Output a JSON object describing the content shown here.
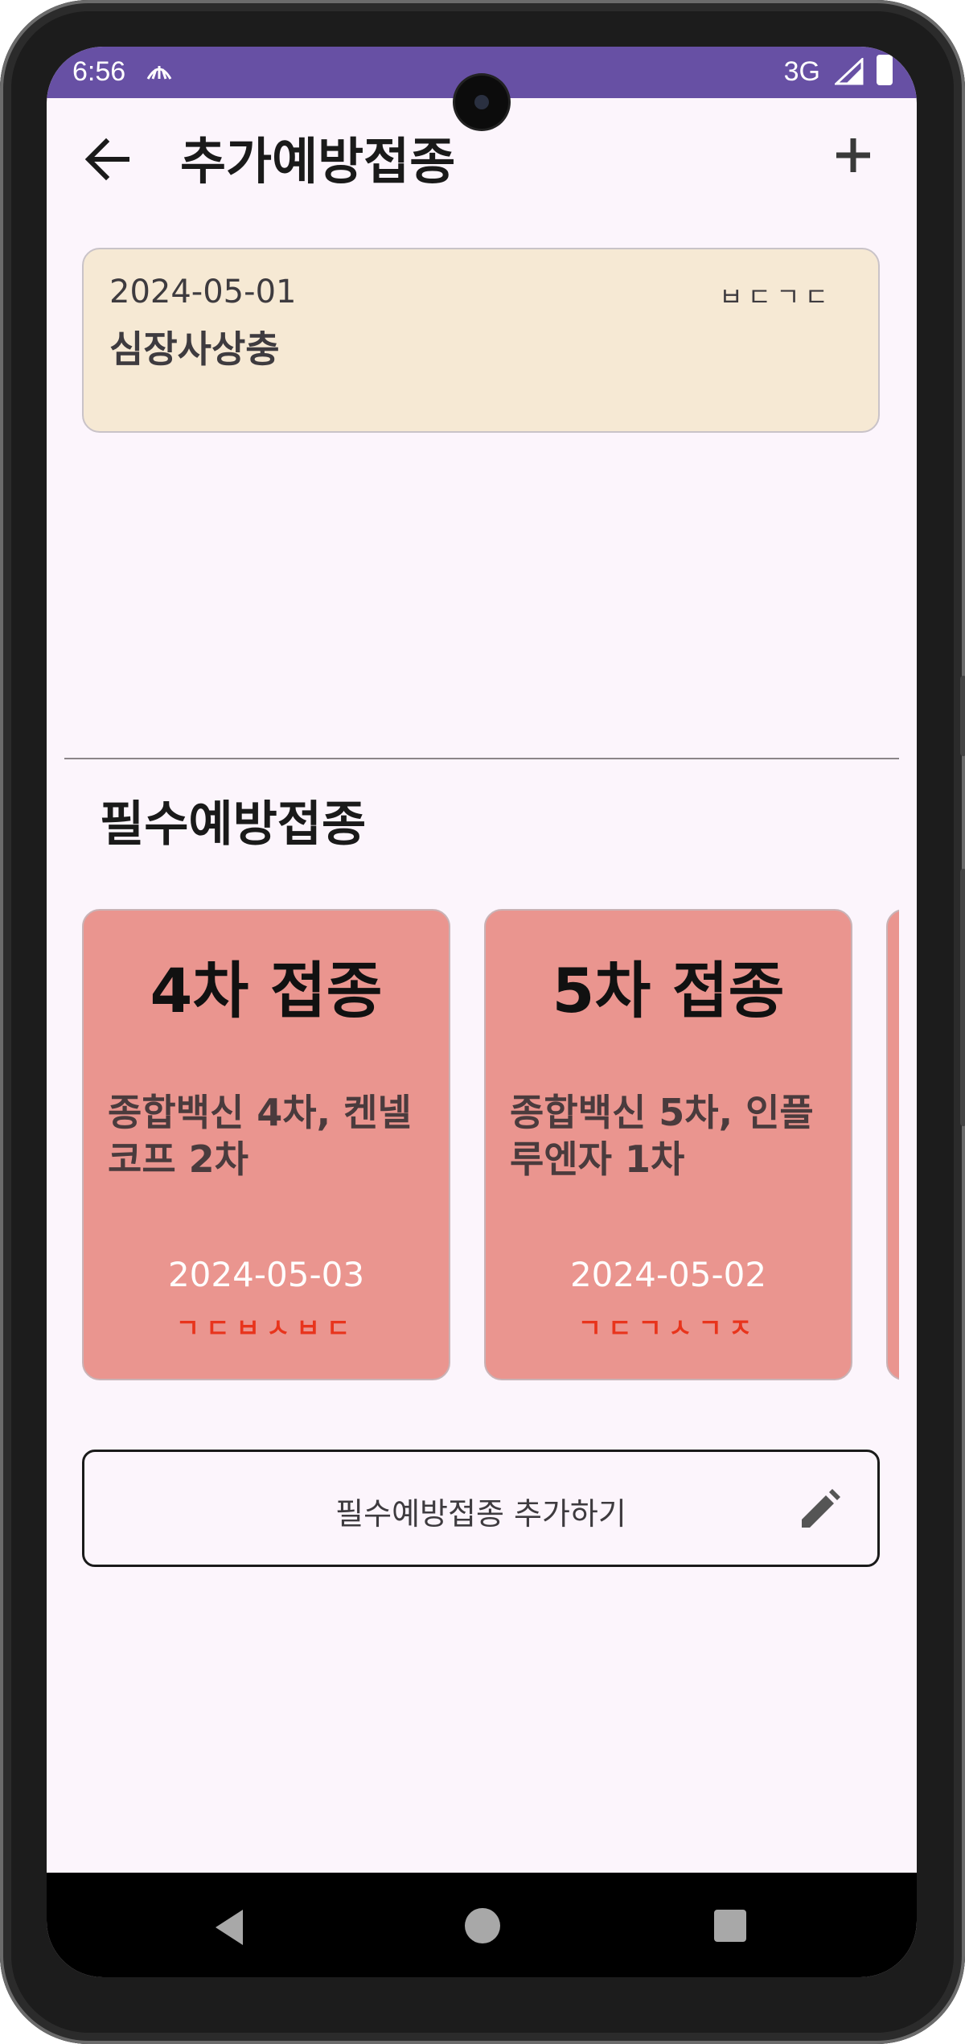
{
  "status_bar": {
    "time": "6:56",
    "network": "3G"
  },
  "app_bar": {
    "title": "추가예방접종"
  },
  "extra_vaccinations": [
    {
      "date": "2024-05-01",
      "tag": "ㅂㄷㄱㄷ",
      "name": "심장사상충"
    }
  ],
  "required_section": {
    "title": "필수예방접종"
  },
  "required_vaccinations": [
    {
      "title": "4차 접종",
      "description": "종합백신 4차, 켄넬코프 2차",
      "date": "2024-05-03",
      "tag": "ㄱㄷㅂㅅㅂㄷ"
    },
    {
      "title": "5차 접종",
      "description": "종합백신 5차, 인플루엔자 1차",
      "date": "2024-05-02",
      "tag": "ㄱㄷㄱㅅㄱㅈ"
    }
  ],
  "add_required_button": {
    "label": "필수예방접종 추가하기"
  },
  "colors": {
    "status_bar": "#6750a4",
    "background": "#fcf5fc",
    "extra_card": "#f6e9d4",
    "vaccine_card": "#ea958f",
    "tag_red": "#e8341c"
  },
  "icons": [
    "arrow-back-icon",
    "plus-icon",
    "pencil-icon",
    "nav-back-icon",
    "nav-home-icon",
    "nav-recents-icon"
  ]
}
